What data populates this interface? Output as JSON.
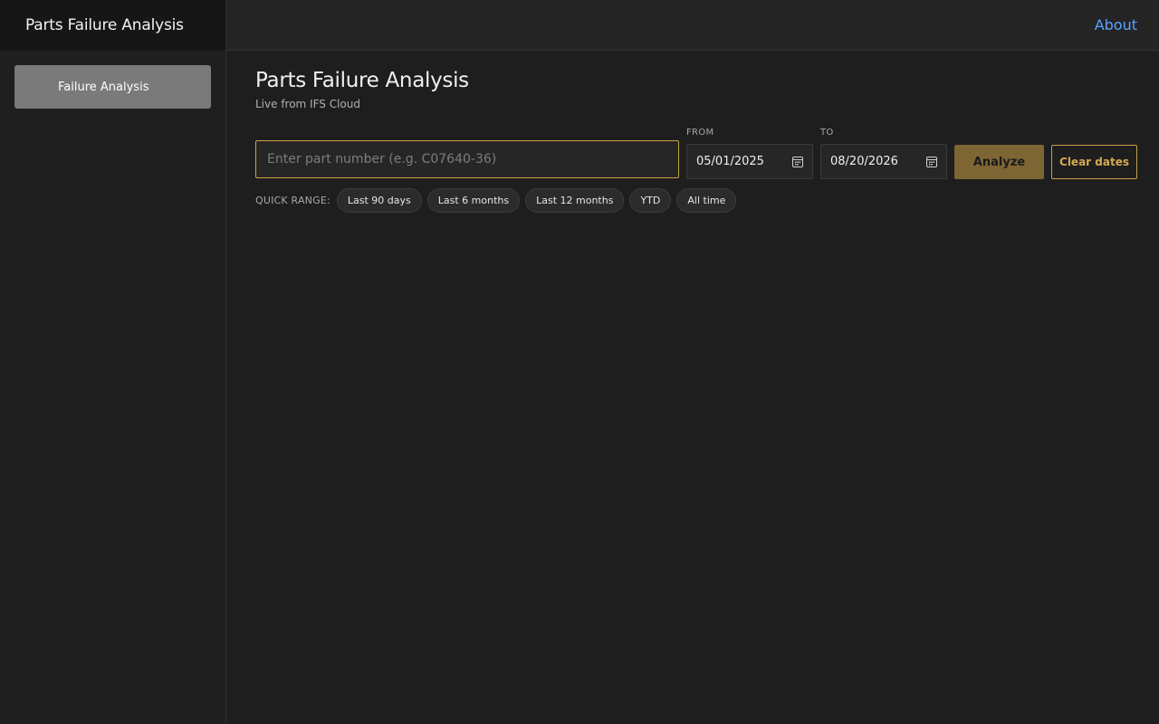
{
  "app": {
    "brand_title": "Parts Failure Analysis",
    "about_label": "About"
  },
  "sidebar": {
    "items": [
      {
        "label": "Failure Analysis",
        "active": true
      }
    ]
  },
  "main": {
    "title": "Parts Failure Analysis",
    "subtitle": "Live from IFS Cloud",
    "search": {
      "value": "",
      "placeholder": "Enter part number (e.g. C07640-36)"
    },
    "from": {
      "label": "FROM",
      "value": "05/01/2025",
      "icon": "calendar-icon"
    },
    "to": {
      "label": "TO",
      "value": "08/20/2026",
      "icon": "calendar-icon"
    },
    "analyze_label": "Analyze",
    "clear_label": "Clear dates",
    "quick_range": {
      "label": "QUICK RANGE:",
      "options": [
        "Last 90 days",
        "Last 6 months",
        "Last 12 months",
        "YTD",
        "All time"
      ]
    }
  },
  "colors": {
    "accent": "#c9a24a",
    "analyze_bg": "#7e6534",
    "link": "#5aa2ff",
    "nav_active_bg": "#7a7a7a"
  }
}
